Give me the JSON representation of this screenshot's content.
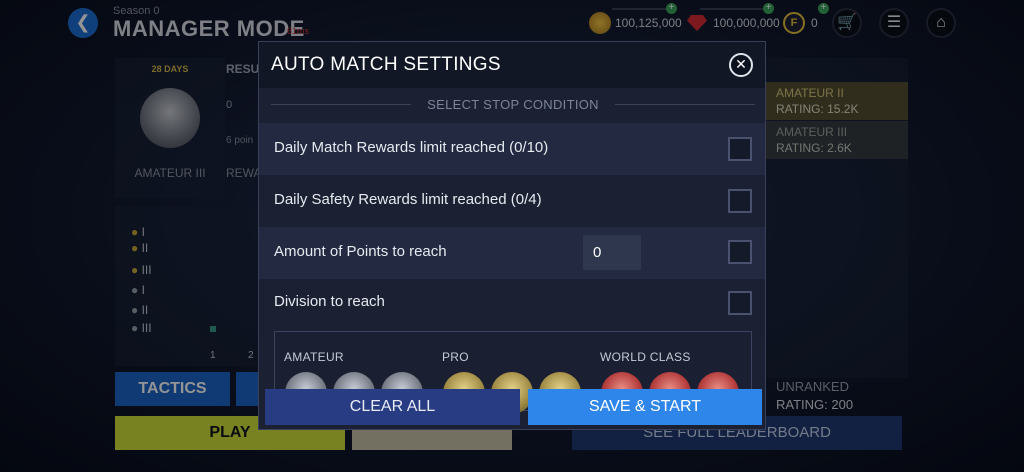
{
  "topbar": {
    "season": "Season 0",
    "mode_title": "MANAGER MODE",
    "ping": "61ms",
    "coins": "100,125,000",
    "gems": "100,000,000",
    "fifa_points": "0"
  },
  "background": {
    "season_days": "28 DAYS",
    "division_name": "AMATEUR III",
    "results_label": "RESU",
    "rewards_label": "REWA",
    "points_fragment": "6 poin",
    "result_value": "0",
    "chart_tiers": [
      "I",
      "II",
      "III",
      "I",
      "II",
      "III"
    ],
    "chart_x": [
      "1",
      "2"
    ],
    "tactics_label": "TACTICS",
    "play_label": "PLAY",
    "leaderboard": [
      {
        "name": "AMATEUR II",
        "rating": "RATING: 15.2K"
      },
      {
        "name": "AMATEUR III",
        "rating": "RATING: 2.6K"
      }
    ],
    "unranked": {
      "name": "UNRANKED",
      "rating": "RATING: 200"
    },
    "see_leaderboard": "SEE FULL LEADERBOARD",
    "colors": {
      "tactics": "#1d64c6",
      "play": "#cfe03a"
    }
  },
  "modal": {
    "title": "AUTO MATCH SETTINGS",
    "section_label": "SELECT STOP CONDITION",
    "conditions": [
      {
        "label": "Daily Match Rewards limit reached (0/10)",
        "checked": false
      },
      {
        "label": "Daily Safety Rewards limit reached (0/4)",
        "checked": false
      },
      {
        "label": "Amount of Points to reach",
        "checked": false,
        "input_value": "0"
      },
      {
        "label": "Division to reach",
        "checked": false
      }
    ],
    "tiers": [
      "AMATEUR",
      "PRO",
      "WORLD CLASS"
    ],
    "clear_label": "CLEAR ALL",
    "save_label": "SAVE & START",
    "colors": {
      "clear": "#283c84",
      "save": "#2f86ea"
    }
  }
}
